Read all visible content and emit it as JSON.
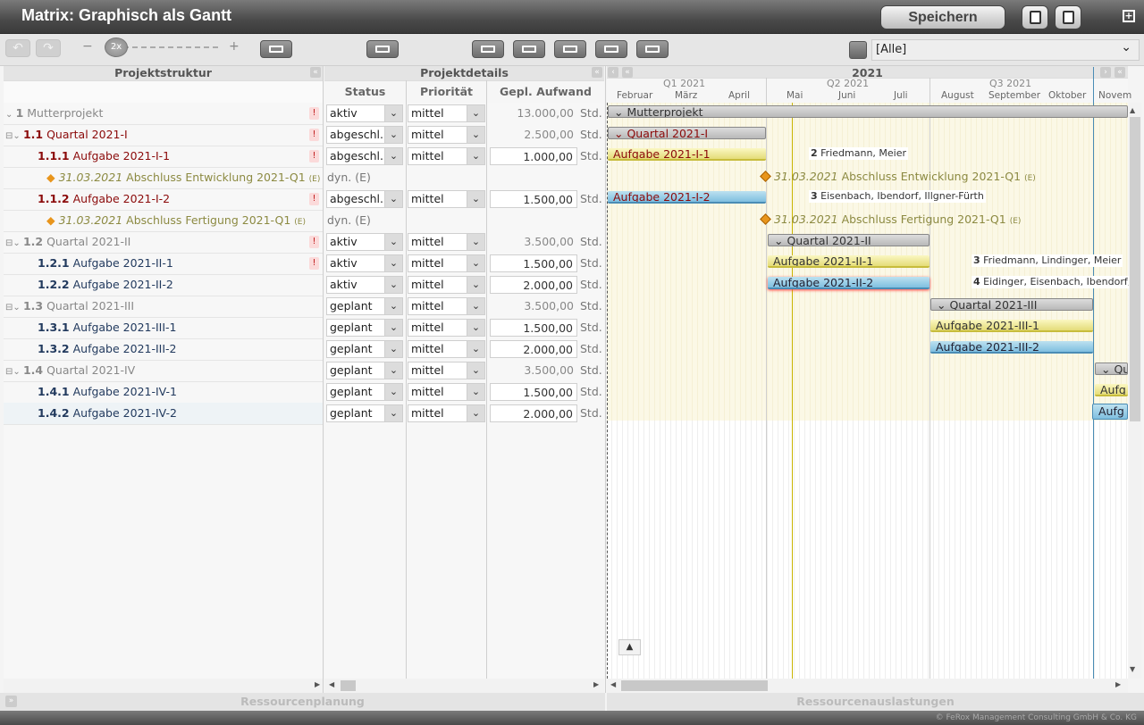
{
  "app": {
    "title": "Matrix: Graphisch als Gantt",
    "save_label": "Speichern",
    "footer": "© FeRox Management Consulting GmbH & Co. KG"
  },
  "toolbar": {
    "zoom_level": "2x",
    "zoom_minus": "−",
    "zoom_plus": "+",
    "filter_value": "[Alle]"
  },
  "panels": {
    "structure": "Projektstruktur",
    "details": "Projektdetails",
    "resource_planning": "Ressourcenplanung",
    "resource_load": "Ressourcenauslastungen"
  },
  "columns": {
    "status": "Status",
    "priority": "Priorität",
    "effort": "Gepl. Aufwand"
  },
  "timeline": {
    "year": "2021",
    "quarters": [
      "Q1 2021",
      "Q2 2021",
      "Q3 2021"
    ],
    "months": [
      "Februar",
      "März",
      "April",
      "Mai",
      "Juni",
      "Juli",
      "August",
      "September",
      "Oktober",
      "Novem"
    ]
  },
  "rows": [
    {
      "code": "1",
      "name": "Mutterprojekt",
      "status": "aktiv",
      "priority": "mittel",
      "effort": "13.000,00",
      "unit": "Std."
    },
    {
      "code": "1.1",
      "name": "Quartal 2021-I",
      "status": "abgeschl.",
      "priority": "mittel",
      "effort": "2.500,00",
      "unit": "Std."
    },
    {
      "code": "1.1.1",
      "name": "Aufgabe 2021-I-1",
      "status": "abgeschl.",
      "priority": "mittel",
      "effort": "1.000,00",
      "unit": "Std."
    },
    {
      "date": "31.03.2021",
      "name": "Abschluss Entwicklung 2021-Q1",
      "tag": "(E)",
      "status": "dyn. (E)"
    },
    {
      "code": "1.1.2",
      "name": "Aufgabe 2021-I-2",
      "status": "abgeschl.",
      "priority": "mittel",
      "effort": "1.500,00",
      "unit": "Std."
    },
    {
      "date": "31.03.2021",
      "name": "Abschluss Fertigung 2021-Q1",
      "tag": "(E)",
      "status": "dyn. (E)"
    },
    {
      "code": "1.2",
      "name": "Quartal 2021-II",
      "status": "aktiv",
      "priority": "mittel",
      "effort": "3.500,00",
      "unit": "Std."
    },
    {
      "code": "1.2.1",
      "name": "Aufgabe 2021-II-1",
      "status": "aktiv",
      "priority": "mittel",
      "effort": "1.500,00",
      "unit": "Std."
    },
    {
      "code": "1.2.2",
      "name": "Aufgabe 2021-II-2",
      "status": "aktiv",
      "priority": "mittel",
      "effort": "2.000,00",
      "unit": "Std."
    },
    {
      "code": "1.3",
      "name": "Quartal 2021-III",
      "status": "geplant",
      "priority": "mittel",
      "effort": "3.500,00",
      "unit": "Std."
    },
    {
      "code": "1.3.1",
      "name": "Aufgabe 2021-III-1",
      "status": "geplant",
      "priority": "mittel",
      "effort": "1.500,00",
      "unit": "Std."
    },
    {
      "code": "1.3.2",
      "name": "Aufgabe 2021-III-2",
      "status": "geplant",
      "priority": "mittel",
      "effort": "2.000,00",
      "unit": "Std."
    },
    {
      "code": "1.4",
      "name": "Quartal 2021-IV",
      "status": "geplant",
      "priority": "mittel",
      "effort": "3.500,00",
      "unit": "Std."
    },
    {
      "code": "1.4.1",
      "name": "Aufgabe 2021-IV-1",
      "status": "geplant",
      "priority": "mittel",
      "effort": "1.500,00",
      "unit": "Std."
    },
    {
      "code": "1.4.2",
      "name": "Aufgabe 2021-IV-2",
      "status": "geplant",
      "priority": "mittel",
      "effort": "2.000,00",
      "unit": "Std."
    }
  ],
  "gantt": {
    "bars": [
      "Mutterprojekt",
      "Quartal 2021-I",
      "Aufgabe 2021-I-1",
      "Aufgabe 2021-I-2",
      "Quartal 2021-II",
      "Aufgabe 2021-II-1",
      "Aufgabe 2021-II-2",
      "Quartal 2021-III",
      "Aufgabe 2021-III-1",
      "Aufgabe 2021-III-2",
      "Qu",
      "Aufg",
      "Aufg"
    ],
    "assignments": [
      {
        "count": "2",
        "names": "Friedmann, Meier"
      },
      {
        "count": "3",
        "names": "Eisenbach, Ibendorf, Illgner-Fürth"
      },
      {
        "count": "3",
        "names": "Friedmann, Lindinger, Meier"
      },
      {
        "count": "4",
        "names": "Eidinger, Eisenbach, Ibendorf,"
      }
    ],
    "milestones": [
      {
        "date": "31.03.2021",
        "name": "Abschluss Entwicklung 2021-Q1",
        "tag": "(E)"
      },
      {
        "date": "31.03.2021",
        "name": "Abschluss Fertigung 2021-Q1",
        "tag": "(E)"
      }
    ]
  }
}
